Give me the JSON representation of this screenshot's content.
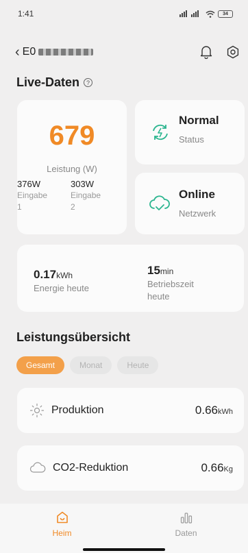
{
  "status_bar": {
    "time": "1:41",
    "signal": "ᴴᴵᴵ ᴴᴵᴵ",
    "battery": "34"
  },
  "header": {
    "device_name": "E0"
  },
  "live": {
    "title": "Live-Daten",
    "power_value": "679",
    "power_label": "Leistung (W)",
    "inputs": [
      {
        "value": "376W",
        "label1": "Eingabe",
        "label2": "1"
      },
      {
        "value": "303W",
        "label1": "Eingabe",
        "label2": "2"
      }
    ],
    "status_title": "Normal",
    "status_sub": "Status",
    "network_title": "Online",
    "network_sub": "Netzwerk",
    "energy_value": "0.17",
    "energy_unit": "kWh",
    "energy_label": "Energie heute",
    "runtime_value": "15",
    "runtime_unit": "min",
    "runtime_label1": "Betriebszeit",
    "runtime_label2": "heute"
  },
  "overview": {
    "title": "Leistungsübersicht",
    "tabs": [
      "Gesamt",
      "Monat",
      "Heute"
    ],
    "production_label": "Produktion",
    "production_value": "0.66",
    "production_unit": "kWh",
    "co2_label": "CO2-Reduktion",
    "co2_value": "0.66",
    "co2_unit": "Kg"
  },
  "nav": {
    "home": "Heim",
    "data": "Daten"
  },
  "colors": {
    "accent": "#f08a26",
    "teal": "#2bb58f"
  }
}
